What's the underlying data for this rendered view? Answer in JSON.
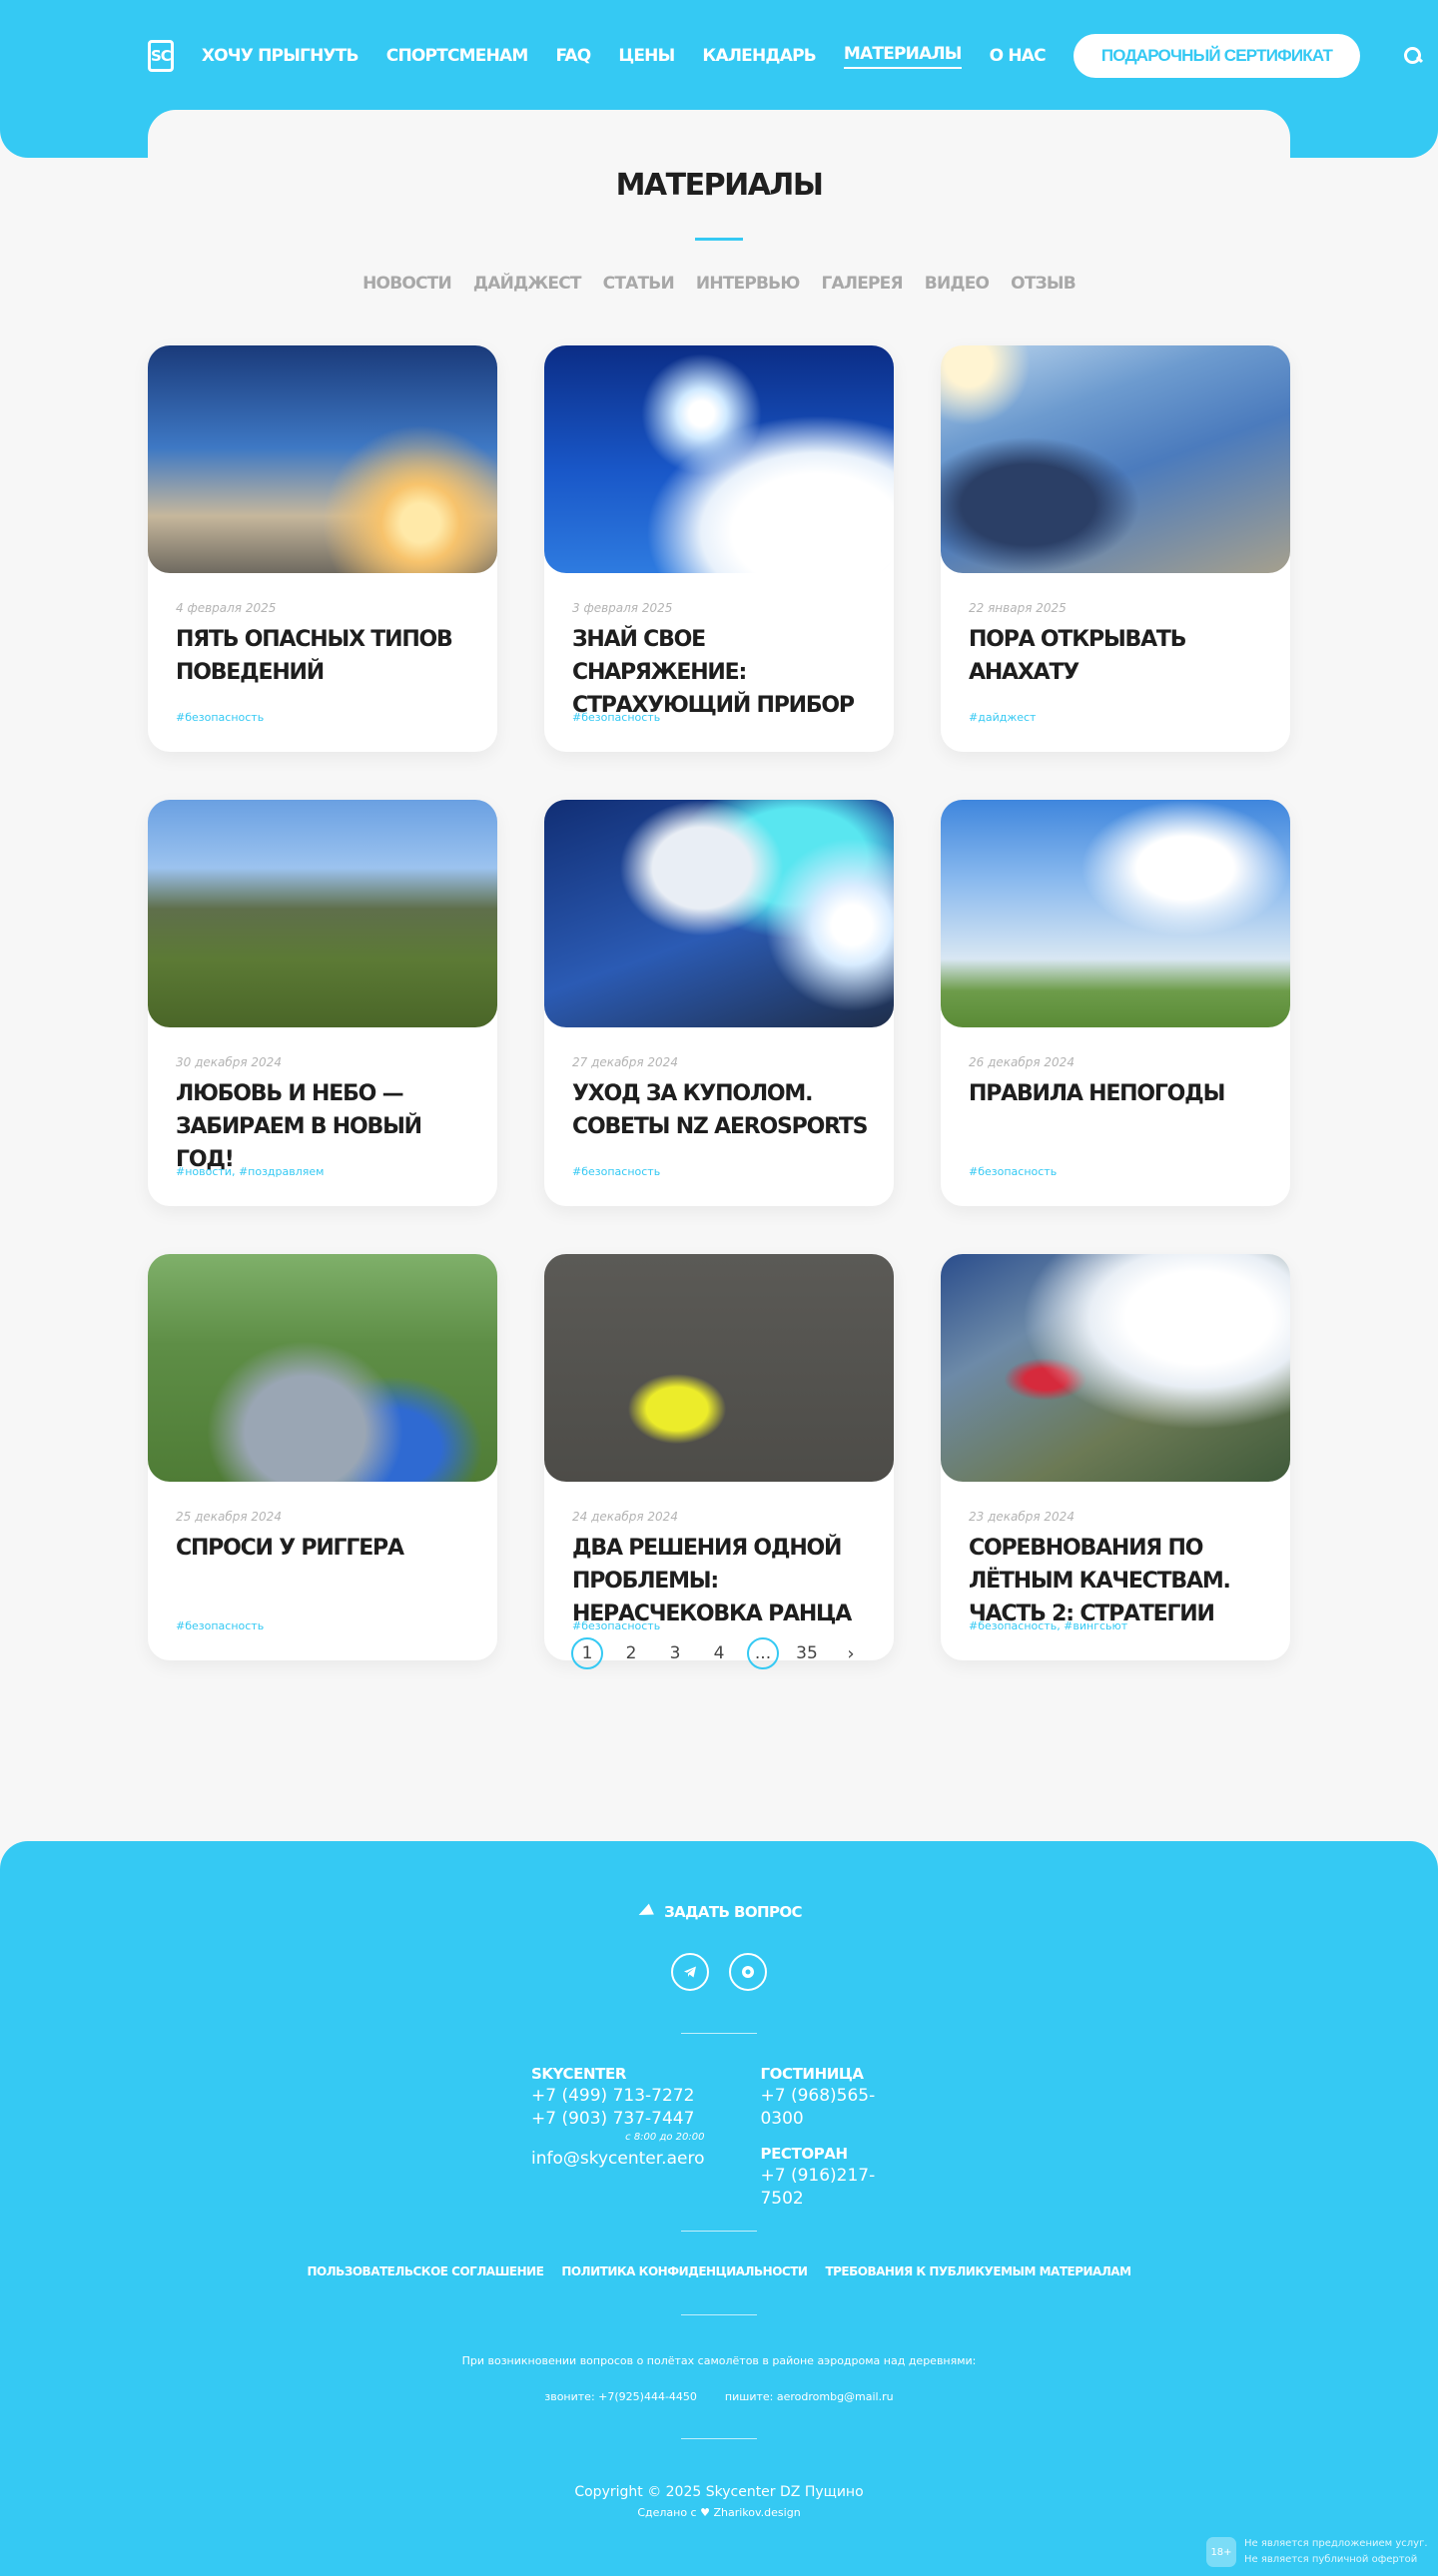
{
  "header": {
    "logo": "SC",
    "nav": [
      "ХОЧУ ПРЫГНУТЬ",
      "СПОРТСМЕНАМ",
      "FAQ",
      "ЦЕНЫ",
      "КАЛЕНДАРЬ",
      "МАТЕРИАЛЫ",
      "О НАС"
    ],
    "active_nav": "МАТЕРИАЛЫ",
    "cert_button": "ПОДАРОЧНЫЙ СЕРТИФИКАТ"
  },
  "main": {
    "title": "МАТЕРИАЛЫ",
    "filters": [
      "НОВОСТИ",
      "ДАЙДЖЕСТ",
      "СТАТЬИ",
      "ИНТЕРВЬЮ",
      "ГАЛЕРЕЯ",
      "ВИДЕО",
      "ОТЗЫВ"
    ]
  },
  "cards": [
    {
      "date": "4 февраля 2025",
      "title": "ПЯТЬ ОПАСНЫХ ТИПОВ ПОВЕДЕНИЙ",
      "tags": "#безопасность",
      "image": "skydivers-formation-sunset"
    },
    {
      "date": "3 февраля 2025",
      "title": "ЗНАЙ СВОЕ СНАРЯЖЕНИЕ: СТРАХУЮЩИЙ ПРИБОР",
      "tags": "#безопасность",
      "image": "skydiver-blue-sky-clouds"
    },
    {
      "date": "22 января 2025",
      "title": "ПОРА ОТКРЫВАТЬ АНАХАТУ",
      "tags": "#дайджест",
      "image": "skydiver-exit-aircraft"
    },
    {
      "date": "30 декабря 2024",
      "title": "ЛЮБОВЬ И НЕБО — ЗАБИРАЕМ В НОВЫЙ ГОД!",
      "tags": "#новости, #поздравляем",
      "image": "couple-airfield"
    },
    {
      "date": "27 декабря 2024",
      "title": "УХОД ЗА КУПОЛОМ. СОВЕТЫ NZ AEROSPORTS",
      "tags": "#безопасность",
      "image": "canopy-opening"
    },
    {
      "date": "26 декабря 2024",
      "title": "ПРАВИЛА НЕПОГОДЫ",
      "tags": "#безопасность",
      "image": "man-windsock-field"
    },
    {
      "date": "25 декабря 2024",
      "title": "СПРОСИ У РИГГЕРА",
      "tags": "#безопасность",
      "image": "packing-parachute"
    },
    {
      "date": "24 декабря 2024",
      "title": "ДВА РЕШЕНИЯ ОДНОЙ ПРОБЛЕМЫ: НЕРАСЧЕКОВКА РАНЦА",
      "tags": "#безопасность",
      "image": "yellow-handle-cable"
    },
    {
      "date": "23 декабря 2024",
      "title": "СОРЕВНОВАНИЯ ПО ЛЁТНЫМ КАЧЕСТВАМ. ЧАСТЬ 2: СТРАТЕГИИ",
      "tags": "#безопасность, #вингсьют",
      "image": "wingsuit-clouds"
    }
  ],
  "pagination": {
    "pages": [
      "1",
      "2",
      "3",
      "4",
      "...",
      "35"
    ],
    "current": "1",
    "next": "›"
  },
  "footer": {
    "ask": "ЗАДАТЬ ВОПРОС",
    "skycenter": {
      "heading": "SKYCENTER",
      "phone1": "+7 (499) 713-7272",
      "phone2": "+7 (903) 737-7447",
      "hours": "с 8:00 до 20:00",
      "email": "info@skycenter.aero"
    },
    "hotel": {
      "heading": "ГОСТИНИЦА",
      "phone": "+7 (968)565-0300"
    },
    "restaurant": {
      "heading": "РЕСТОРАН",
      "phone": "+7 (916)217-7502"
    },
    "links": [
      "ПОЛЬЗОВАТЕЛЬСКОЕ СОГЛАШЕНИЕ",
      "ПОЛИТИКА КОНФИДЕНЦИАЛЬНОСТИ",
      "ТРЕБОВАНИЯ К ПУБЛИКУЕМЫМ МАТЕРИАЛАМ"
    ],
    "notice": "При возникновении вопросов о полётах самолётов в районе аэродрома над деревнями:",
    "call": "звоните: +7(925)444-4450",
    "write": "пишите: aerodrombg@mail.ru",
    "copyright": "Copyright © 2025 Skycenter DZ Пущино",
    "made_prefix": "Сделано с",
    "made_by": "Zharikov.design",
    "age_badge": "18+",
    "age_line1": "Не является предложением услуг.",
    "age_line2": "Не является публичной офертой"
  },
  "colors": {
    "accent": "#35c9f3",
    "background": "#f7f7f7"
  }
}
